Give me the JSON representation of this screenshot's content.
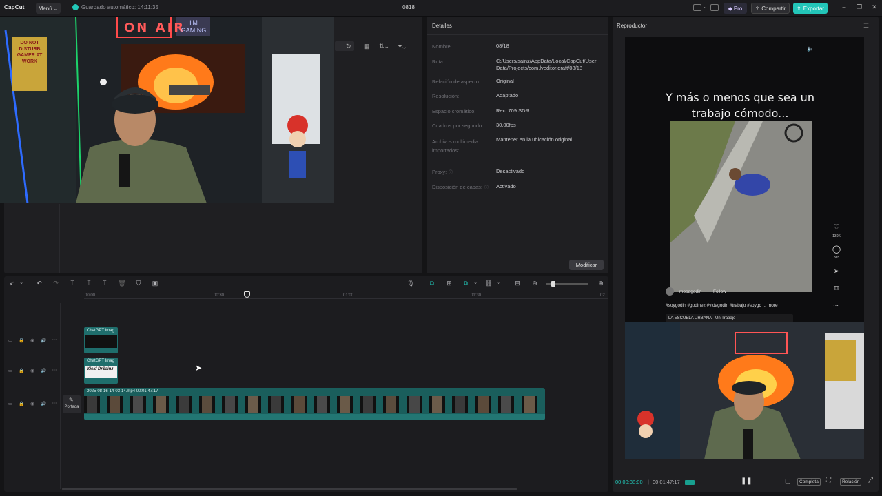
{
  "app": {
    "logo": "CapCut",
    "menu_label": "Menú",
    "autosave": "Guardado automático: 14:11:35",
    "project_title": "0818",
    "pro_label": "Pro",
    "share_label": "Compartir",
    "export_label": "Exportar"
  },
  "webcam": {
    "neon_sign": "ON AIR",
    "gaming_sign": "I'M GAMING",
    "poster": "DO NOT DISTURB GAMER AT WORK"
  },
  "details": {
    "title": "Detalles",
    "rows": [
      {
        "label": "Nombre:",
        "value": "08/18"
      },
      {
        "label": "Ruta:",
        "value": "C:/Users/sainz/AppData/Local/CapCut/User Data/Projects/com.lveditor.draft/08/18"
      },
      {
        "label": "Relación de aspecto:",
        "value": "Original"
      },
      {
        "label": "Resolución:",
        "value": "Adaptado"
      },
      {
        "label": "Espacio cromático:",
        "value": "Rec. 709 SDR"
      },
      {
        "label": "Cuadros por segundo:",
        "value": "30.00fps"
      },
      {
        "label": "Archivos multimedia importados:",
        "value": "Mantener en la ubicación original"
      },
      {
        "label": "Proxy:",
        "value": "Desactivado"
      },
      {
        "label": "Disposición de capas:",
        "value": "Activado"
      }
    ],
    "modify_label": "Modificar"
  },
  "player": {
    "title": "Reproductor",
    "caption": "Y más o menos que sea un trabajo cómodo...",
    "likes": "130K",
    "comments": "865",
    "username": "moodgodin",
    "follow": "Follow",
    "hashtags": "#soygodin #godinez #vidagodin #trabajo #soygc ... more",
    "music": "LA ESCUELA URBANA - Un Trabajo",
    "time_current": "00:00:38:00",
    "time_total": "00:01:47:17",
    "full_label": "Completa",
    "ratio_label": "Relación"
  },
  "timeline": {
    "ruler": [
      "00:00",
      "00:30",
      "01:00",
      "01:30",
      "02"
    ],
    "clip1_label": "ChatGPT Imag",
    "clip2_label": "ChatGPT Imag",
    "clip2_text": "Kick/ DrSainz",
    "main_clip_label": "2025-08-16-14-03-14.mp4   00:01:47:17",
    "cover_label": "Portada"
  },
  "colors": {
    "accent": "#22c7b8",
    "clip": "#1a5e5c",
    "background": "#141416",
    "panel": "#1f1f22"
  }
}
